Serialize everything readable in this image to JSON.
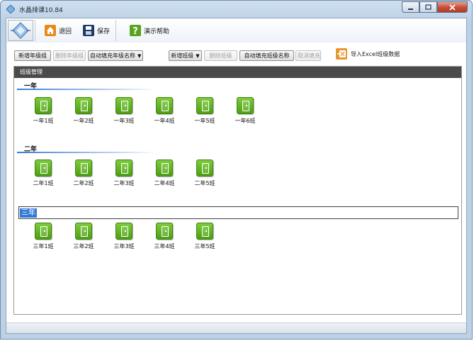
{
  "window": {
    "title": "水晶排课10.84"
  },
  "toolbar": {
    "back_label": "退回",
    "save_label": "保存",
    "help_label": "演示帮助"
  },
  "controls": {
    "add_grade": "新增年级组",
    "delete_grade": "删除年级组",
    "autofill_grade": "自动填充年级名称",
    "add_class": "新增班级",
    "delete_class": "删除班级",
    "autofill_class": "自动填充班级名称",
    "cancel_fill": "取消填充",
    "import_excel": "导入Excel班级数据"
  },
  "panel": {
    "header": "班级管理"
  },
  "grades": [
    {
      "name": "一年",
      "classes": [
        "一年1班",
        "一年2班",
        "一年3班",
        "一年4班",
        "一年5班",
        "一年6班"
      ]
    },
    {
      "name": "二年",
      "classes": [
        "二年1班",
        "二年2班",
        "二年3班",
        "二年4班",
        "二年5班"
      ]
    },
    {
      "name": "三年",
      "classes": [
        "三年1班",
        "三年2班",
        "三年3班",
        "三年4班",
        "三年5班"
      ]
    }
  ],
  "colors": {
    "panel_header": "#4a4a4a",
    "class_icon": "#5fae22",
    "selection": "#3179d8"
  },
  "icons": {
    "back": "home-icon",
    "save": "floppy-icon",
    "help": "question-icon",
    "excel": "excel-import-icon",
    "class": "door-icon"
  }
}
